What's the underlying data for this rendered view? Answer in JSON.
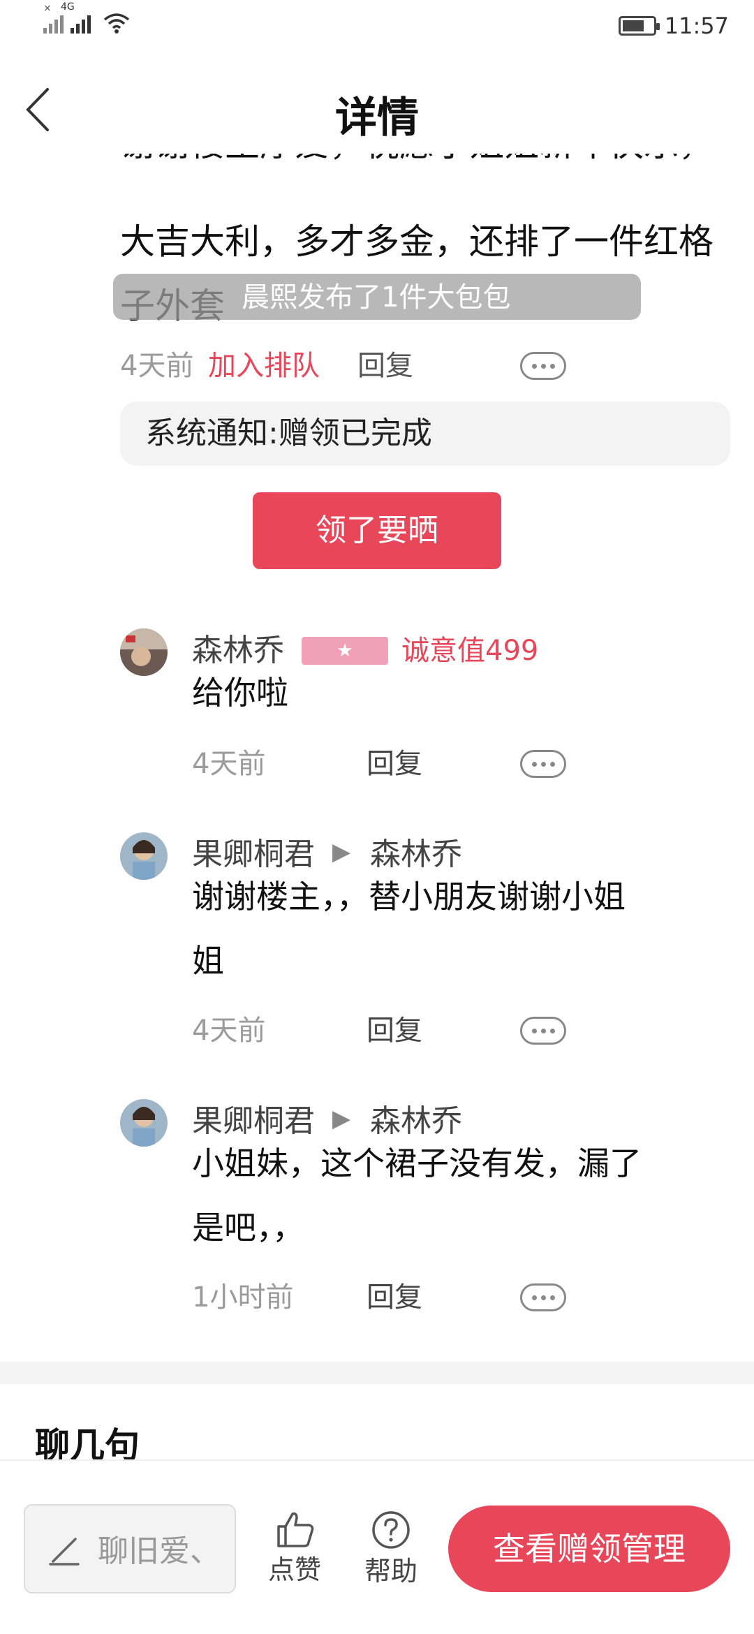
{
  "status_bar": {
    "sim1_label": "×",
    "sim2_label": "4G",
    "time": "11:57"
  },
  "header": {
    "title": "详情",
    "back_icon": "chevron-left-icon"
  },
  "post": {
    "line1_clipped": "谢谢楼主厚爱，祝愿小姐姐新年快乐，",
    "line2": "大吉大利，多才多金，还排了一件红格",
    "line3": "子外套",
    "time": "4天前",
    "join_queue": "加入排队",
    "reply": "回复"
  },
  "toast": {
    "text": "晨熙发布了1件大包包"
  },
  "system_note": {
    "text": "系统通知:赠领已完成"
  },
  "show_button": {
    "label": "领了要晒"
  },
  "comments": [
    {
      "author": "森林乔",
      "badge_icon": "star-icon",
      "sincerity": "诚意值499",
      "body_lines": [
        "给你啦"
      ],
      "time": "4天前",
      "reply": "回复"
    },
    {
      "author": "果卿桐君",
      "reply_to": "森林乔",
      "body_lines": [
        "谢谢楼主，，替小朋友谢谢小姐",
        "姐"
      ],
      "time": "4天前",
      "reply": "回复"
    },
    {
      "author": "果卿桐君",
      "reply_to": "森林乔",
      "body_lines": [
        "小姐妹，这个裙子没有发，漏了",
        "是吧，，"
      ],
      "time": "1小时前",
      "reply": "回复"
    }
  ],
  "chat_section": {
    "title": "聊几句"
  },
  "bottom_bar": {
    "input_placeholder": "聊旧爱、",
    "like_label": "点赞",
    "help_label": "帮助",
    "cta_label": "查看赠领管理"
  },
  "colors": {
    "accent": "#e8475a",
    "badge": "#f0a0b8",
    "muted": "#9b9b9b"
  }
}
